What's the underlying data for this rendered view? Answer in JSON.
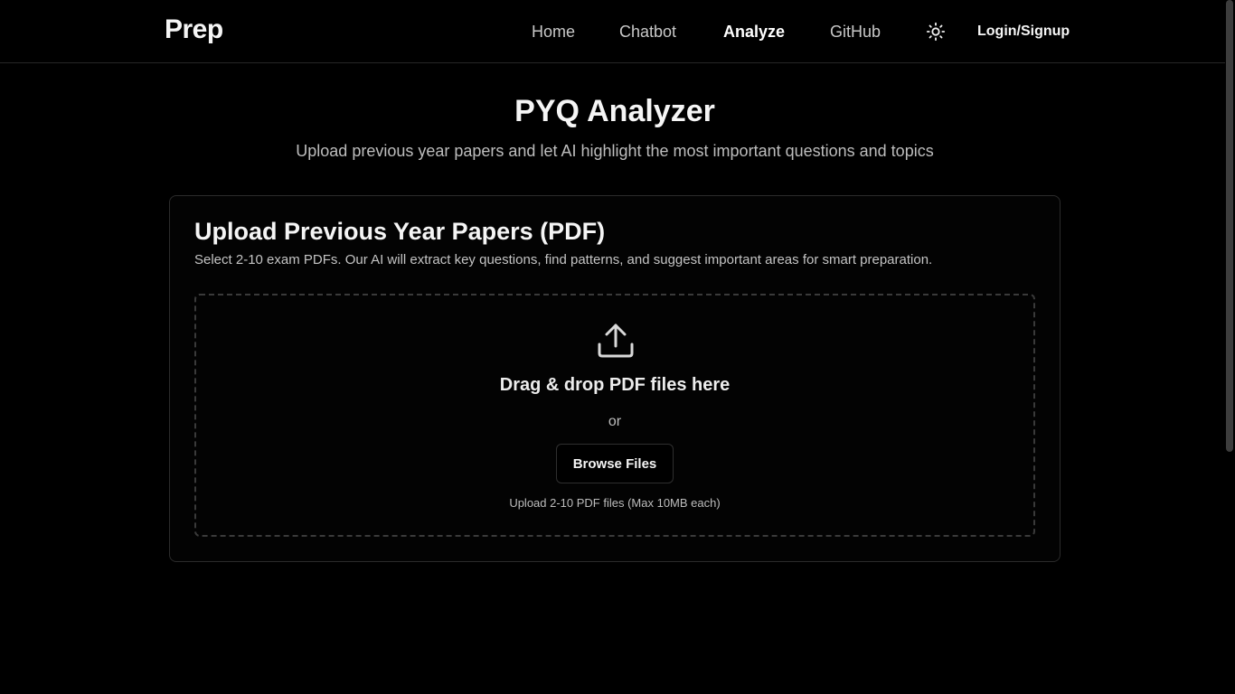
{
  "header": {
    "brand": "Prep",
    "nav": {
      "home": "Home",
      "chatbot": "Chatbot",
      "analyze": "Analyze",
      "github": "GitHub"
    },
    "theme_toggle_icon": "sun-icon",
    "login": "Login/Signup"
  },
  "hero": {
    "title": "PYQ Analyzer",
    "subtitle": "Upload previous year papers and let AI highlight the most important questions and topics"
  },
  "upload_card": {
    "title": "Upload Previous Year Papers (PDF)",
    "description": "Select 2-10 exam PDFs. Our AI will extract key questions, find patterns, and suggest important areas for smart preparation.",
    "dropzone": {
      "icon": "upload-icon",
      "title": "Drag & drop PDF files here",
      "or_text": "or",
      "browse_label": "Browse Files",
      "hint": "Upload 2-10 PDF files (Max 10MB each)"
    }
  },
  "colors": {
    "background": "#000000",
    "text": "#f5f5f5",
    "muted": "#bdbdbd",
    "border": "#2b2b2b"
  }
}
